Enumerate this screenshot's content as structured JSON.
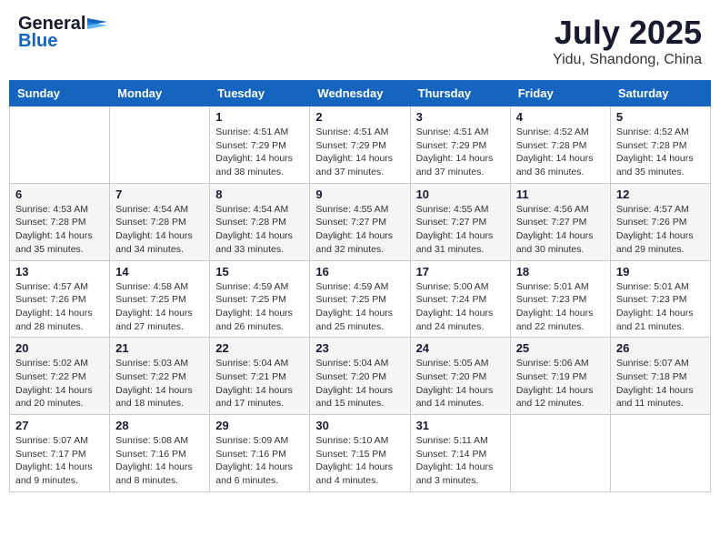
{
  "header": {
    "logo_general": "General",
    "logo_blue": "Blue",
    "month_year": "July 2025",
    "location": "Yidu, Shandong, China"
  },
  "days_of_week": [
    "Sunday",
    "Monday",
    "Tuesday",
    "Wednesday",
    "Thursday",
    "Friday",
    "Saturday"
  ],
  "weeks": [
    [
      {
        "day": "",
        "info": ""
      },
      {
        "day": "",
        "info": ""
      },
      {
        "day": "1",
        "info": "Sunrise: 4:51 AM\nSunset: 7:29 PM\nDaylight: 14 hours and 38 minutes."
      },
      {
        "day": "2",
        "info": "Sunrise: 4:51 AM\nSunset: 7:29 PM\nDaylight: 14 hours and 37 minutes."
      },
      {
        "day": "3",
        "info": "Sunrise: 4:51 AM\nSunset: 7:29 PM\nDaylight: 14 hours and 37 minutes."
      },
      {
        "day": "4",
        "info": "Sunrise: 4:52 AM\nSunset: 7:28 PM\nDaylight: 14 hours and 36 minutes."
      },
      {
        "day": "5",
        "info": "Sunrise: 4:52 AM\nSunset: 7:28 PM\nDaylight: 14 hours and 35 minutes."
      }
    ],
    [
      {
        "day": "6",
        "info": "Sunrise: 4:53 AM\nSunset: 7:28 PM\nDaylight: 14 hours and 35 minutes."
      },
      {
        "day": "7",
        "info": "Sunrise: 4:54 AM\nSunset: 7:28 PM\nDaylight: 14 hours and 34 minutes."
      },
      {
        "day": "8",
        "info": "Sunrise: 4:54 AM\nSunset: 7:28 PM\nDaylight: 14 hours and 33 minutes."
      },
      {
        "day": "9",
        "info": "Sunrise: 4:55 AM\nSunset: 7:27 PM\nDaylight: 14 hours and 32 minutes."
      },
      {
        "day": "10",
        "info": "Sunrise: 4:55 AM\nSunset: 7:27 PM\nDaylight: 14 hours and 31 minutes."
      },
      {
        "day": "11",
        "info": "Sunrise: 4:56 AM\nSunset: 7:27 PM\nDaylight: 14 hours and 30 minutes."
      },
      {
        "day": "12",
        "info": "Sunrise: 4:57 AM\nSunset: 7:26 PM\nDaylight: 14 hours and 29 minutes."
      }
    ],
    [
      {
        "day": "13",
        "info": "Sunrise: 4:57 AM\nSunset: 7:26 PM\nDaylight: 14 hours and 28 minutes."
      },
      {
        "day": "14",
        "info": "Sunrise: 4:58 AM\nSunset: 7:25 PM\nDaylight: 14 hours and 27 minutes."
      },
      {
        "day": "15",
        "info": "Sunrise: 4:59 AM\nSunset: 7:25 PM\nDaylight: 14 hours and 26 minutes."
      },
      {
        "day": "16",
        "info": "Sunrise: 4:59 AM\nSunset: 7:25 PM\nDaylight: 14 hours and 25 minutes."
      },
      {
        "day": "17",
        "info": "Sunrise: 5:00 AM\nSunset: 7:24 PM\nDaylight: 14 hours and 24 minutes."
      },
      {
        "day": "18",
        "info": "Sunrise: 5:01 AM\nSunset: 7:23 PM\nDaylight: 14 hours and 22 minutes."
      },
      {
        "day": "19",
        "info": "Sunrise: 5:01 AM\nSunset: 7:23 PM\nDaylight: 14 hours and 21 minutes."
      }
    ],
    [
      {
        "day": "20",
        "info": "Sunrise: 5:02 AM\nSunset: 7:22 PM\nDaylight: 14 hours and 20 minutes."
      },
      {
        "day": "21",
        "info": "Sunrise: 5:03 AM\nSunset: 7:22 PM\nDaylight: 14 hours and 18 minutes."
      },
      {
        "day": "22",
        "info": "Sunrise: 5:04 AM\nSunset: 7:21 PM\nDaylight: 14 hours and 17 minutes."
      },
      {
        "day": "23",
        "info": "Sunrise: 5:04 AM\nSunset: 7:20 PM\nDaylight: 14 hours and 15 minutes."
      },
      {
        "day": "24",
        "info": "Sunrise: 5:05 AM\nSunset: 7:20 PM\nDaylight: 14 hours and 14 minutes."
      },
      {
        "day": "25",
        "info": "Sunrise: 5:06 AM\nSunset: 7:19 PM\nDaylight: 14 hours and 12 minutes."
      },
      {
        "day": "26",
        "info": "Sunrise: 5:07 AM\nSunset: 7:18 PM\nDaylight: 14 hours and 11 minutes."
      }
    ],
    [
      {
        "day": "27",
        "info": "Sunrise: 5:07 AM\nSunset: 7:17 PM\nDaylight: 14 hours and 9 minutes."
      },
      {
        "day": "28",
        "info": "Sunrise: 5:08 AM\nSunset: 7:16 PM\nDaylight: 14 hours and 8 minutes."
      },
      {
        "day": "29",
        "info": "Sunrise: 5:09 AM\nSunset: 7:16 PM\nDaylight: 14 hours and 6 minutes."
      },
      {
        "day": "30",
        "info": "Sunrise: 5:10 AM\nSunset: 7:15 PM\nDaylight: 14 hours and 4 minutes."
      },
      {
        "day": "31",
        "info": "Sunrise: 5:11 AM\nSunset: 7:14 PM\nDaylight: 14 hours and 3 minutes."
      },
      {
        "day": "",
        "info": ""
      },
      {
        "day": "",
        "info": ""
      }
    ]
  ]
}
